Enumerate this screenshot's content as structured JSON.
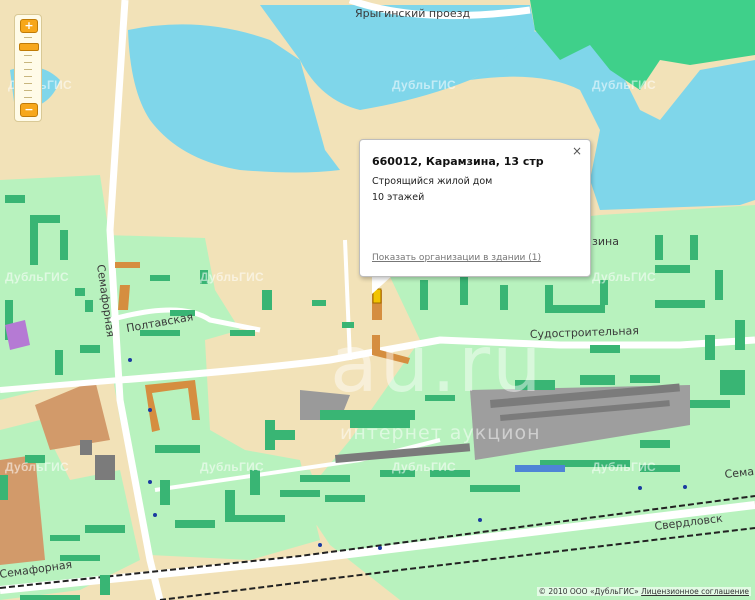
{
  "map": {
    "streets": {
      "yaryginsky": "Ярыгинский проезд",
      "semafornaya": "Семафорная",
      "semafornaya_bottom": "Семафорная",
      "poltavskaya": "Полтавская",
      "sudostroitelnaya": "Судостроительная",
      "sverdlovskaya": "Свердловск",
      "sema_right": "Сема",
      "karamzina_frag": "зина"
    },
    "watermark": "ДубльГИС",
    "au_watermark": "au.ru",
    "au_sub": "интернет аукцион"
  },
  "zoom": {
    "plus": "+",
    "minus": "−"
  },
  "popup": {
    "title": "660012, Карамзина, 13 стр",
    "description": "Строящийся жилой дом",
    "floors": "10 этажей",
    "link": "Показать организации в здании (1)",
    "close": "×"
  },
  "copyright": {
    "text": "© 2010 ООО «ДубльГИС»",
    "license": "Лицензионное соглашение"
  },
  "colors": {
    "land": "#f2e2b8",
    "water": "#7fd6ea",
    "green": "#b8f2be",
    "park": "#3fd08a",
    "building": "#39b574",
    "road": "#ffffff",
    "rail": "#222222"
  }
}
